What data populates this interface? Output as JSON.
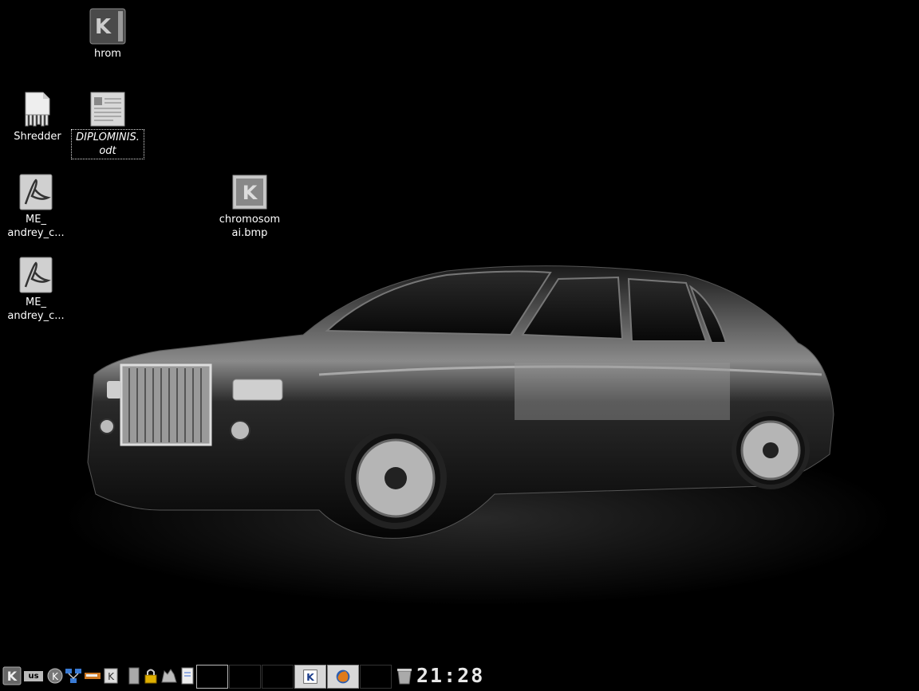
{
  "desktop": {
    "icons": [
      {
        "label": "hrom",
        "icon": "kde-folder-icon"
      },
      {
        "label": "Shredder",
        "icon": "shredder-icon"
      },
      {
        "label": "DIPLOMINIS.\nodt",
        "icon": "document-icon"
      },
      {
        "label": "ME_\nandrey_c...",
        "icon": "pdf-icon"
      },
      {
        "label": "chromosom\nai.bmp",
        "icon": "image-file-icon"
      },
      {
        "label": "ME_\nandrey_c...",
        "icon": "pdf-icon"
      }
    ]
  },
  "taskbar": {
    "keyboard_layout": "us",
    "clock": "21:28",
    "launchers": [
      "kde-menu-icon",
      "keyboard-layout-icon",
      "kde-logo-icon",
      "network-icon",
      "tools-icon",
      "help-icon",
      "terminal-icon",
      "lock-icon",
      "wolf-icon",
      "text-editor-icon"
    ],
    "tasks": [
      "kde-task-icon",
      "firefox-icon"
    ],
    "tray": [
      "trash-icon"
    ]
  }
}
